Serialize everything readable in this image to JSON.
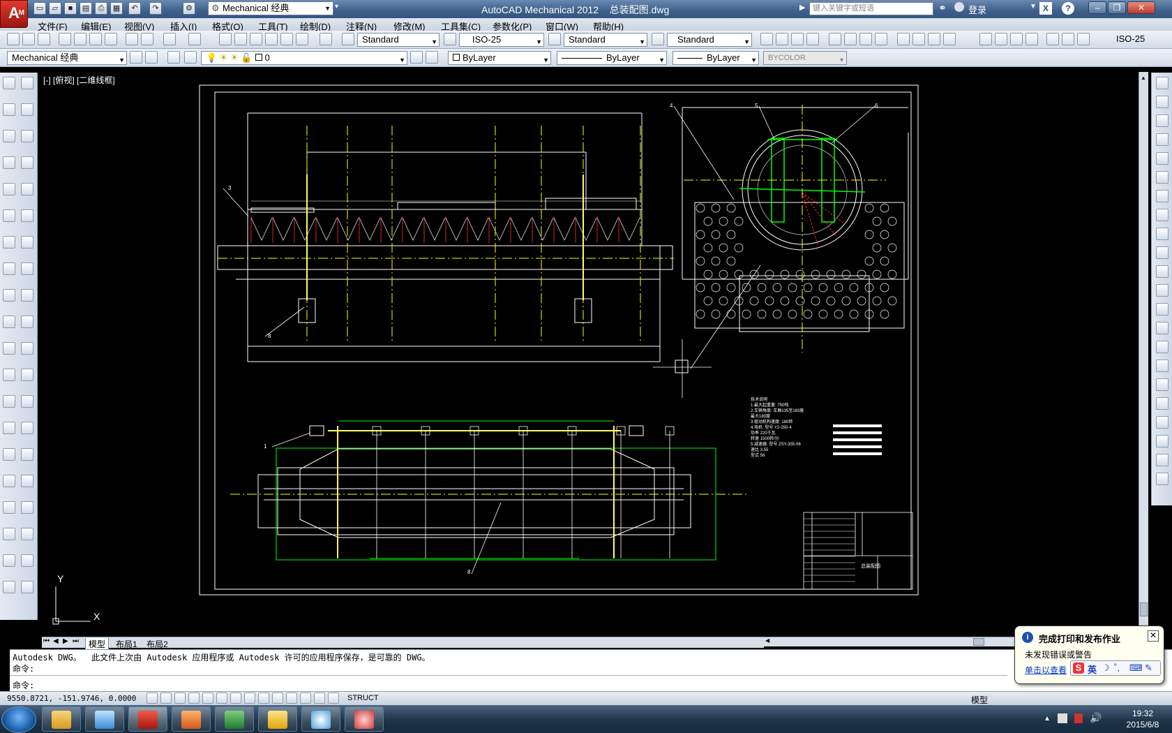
{
  "app": {
    "logo_letter": "A",
    "logo_sub": "M",
    "workspace": "Mechanical 经典",
    "title": "AutoCAD Mechanical 2012    总装配图.dwg",
    "search_placeholder": "键入关键字或短语",
    "login": "登录"
  },
  "menu": [
    "文件(F)",
    "编辑(E)",
    "视图(V)",
    "插入(I)",
    "格式(O)",
    "工具(T)",
    "绘制(D)",
    "注释(N)",
    "修改(M)",
    "工具集(C)",
    "参数化(P)",
    "窗口(W)",
    "帮助(H)"
  ],
  "toolbar1": {
    "text_style": "Standard",
    "dim_style": "ISO-25",
    "table_style": "Standard",
    "mleader_style": "Standard",
    "right_dim_style": "ISO-25"
  },
  "toolbar2": {
    "workspace": "Mechanical 经典",
    "layer": "0",
    "color": "ByLayer",
    "linetype": "ByLayer",
    "lineweight": "ByLayer",
    "plotstyle": "BYCOLOR"
  },
  "viewport_label": "[-] [俯视] [二维线框]",
  "ucs": {
    "x": "X",
    "y": "Y"
  },
  "layout_tabs": [
    "模型",
    "布局1",
    "布局2"
  ],
  "command": {
    "line1": "Autodesk DWG。  此文件上次由 Autodesk 应用程序或 Autodesk 许可的应用程序保存，是可靠的 DWG。",
    "line2": "命令:",
    "line3": "命令:"
  },
  "status": {
    "coords": "9550.8721, -151.9746, 0.0000",
    "struct": "STRUCT",
    "model": "模型"
  },
  "balloon": {
    "title": "完成打印和发布作业",
    "message": "未发现错误或警告",
    "link": "单击以查看"
  },
  "ime": {
    "lang": "英"
  },
  "clock": {
    "time": "19:32",
    "date": "2015/6/8"
  },
  "drawing": {
    "callouts": [
      "3",
      "8",
      "4",
      "5",
      "6",
      "1",
      "8"
    ],
    "title_block_name": "总装配图",
    "notes": [
      "技术说明",
      "1.最大起重量: 750吨",
      "2.车辆角度: 车厢135至183度",
      "      最大180度",
      "3.驱动机构速度: 180转",
      "4.电机: 型号 Y2-250-4",
      "      功率 220千瓦",
      "      转速 1500转/分",
      "5.减速器: 型号 ZSY-355-56",
      "      速比 3.55",
      "      型式 56"
    ]
  },
  "colors": {
    "accent_red": "#e23a2d",
    "cad_yellow": "#ffff00",
    "cad_green": "#00ff00",
    "cad_red": "#ff0000",
    "cad_white": "#ffffff"
  }
}
